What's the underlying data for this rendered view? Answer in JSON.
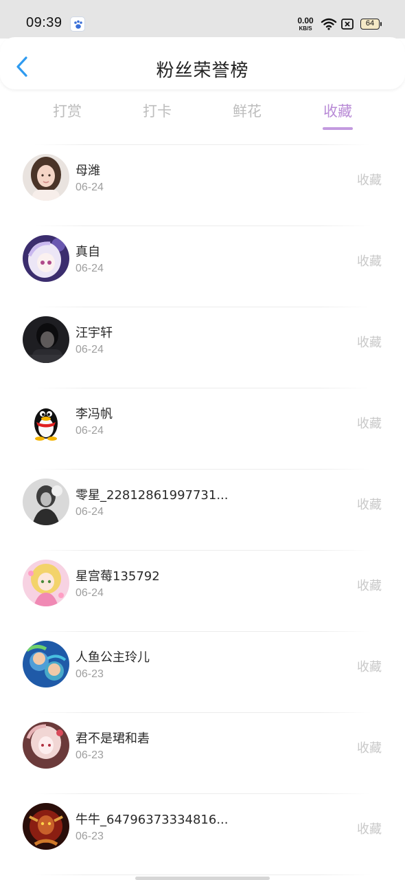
{
  "status": {
    "time": "09:39",
    "net_speed_value": "0.00",
    "net_speed_unit": "KB/S",
    "battery": "64"
  },
  "header": {
    "title": "粉丝荣誉榜"
  },
  "tabs": [
    {
      "label": "打赏",
      "active": false
    },
    {
      "label": "打卡",
      "active": false
    },
    {
      "label": "鲜花",
      "active": false
    },
    {
      "label": "收藏",
      "active": true
    }
  ],
  "colors": {
    "accent": "#b88ad6",
    "back_arrow": "#2f9bf0",
    "inactive_tab": "#bdbdbd"
  },
  "list": [
    {
      "name": "母潍",
      "date": "06-24",
      "action": "收藏",
      "avatar": "girl-photo"
    },
    {
      "name": "真自",
      "date": "06-24",
      "action": "收藏",
      "avatar": "anime-girl-purple"
    },
    {
      "name": "汪宇轩",
      "date": "06-24",
      "action": "收藏",
      "avatar": "dark-portrait"
    },
    {
      "name": "李冯帆",
      "date": "06-24",
      "action": "收藏",
      "avatar": "qq-penguin"
    },
    {
      "name": "零星_22812861997731...",
      "date": "06-24",
      "action": "收藏",
      "avatar": "grayscale-figure"
    },
    {
      "name": "星宫莓135792",
      "date": "06-24",
      "action": "收藏",
      "avatar": "anime-girl-pink"
    },
    {
      "name": "人鱼公主玲儿",
      "date": "06-23",
      "action": "收藏",
      "avatar": "cartoon-underwater"
    },
    {
      "name": "君不是珺和砉",
      "date": "06-23",
      "action": "收藏",
      "avatar": "anime-girl-red"
    },
    {
      "name": "牛牛_64796373334816...",
      "date": "06-23",
      "action": "收藏",
      "avatar": "warrior-art"
    }
  ]
}
